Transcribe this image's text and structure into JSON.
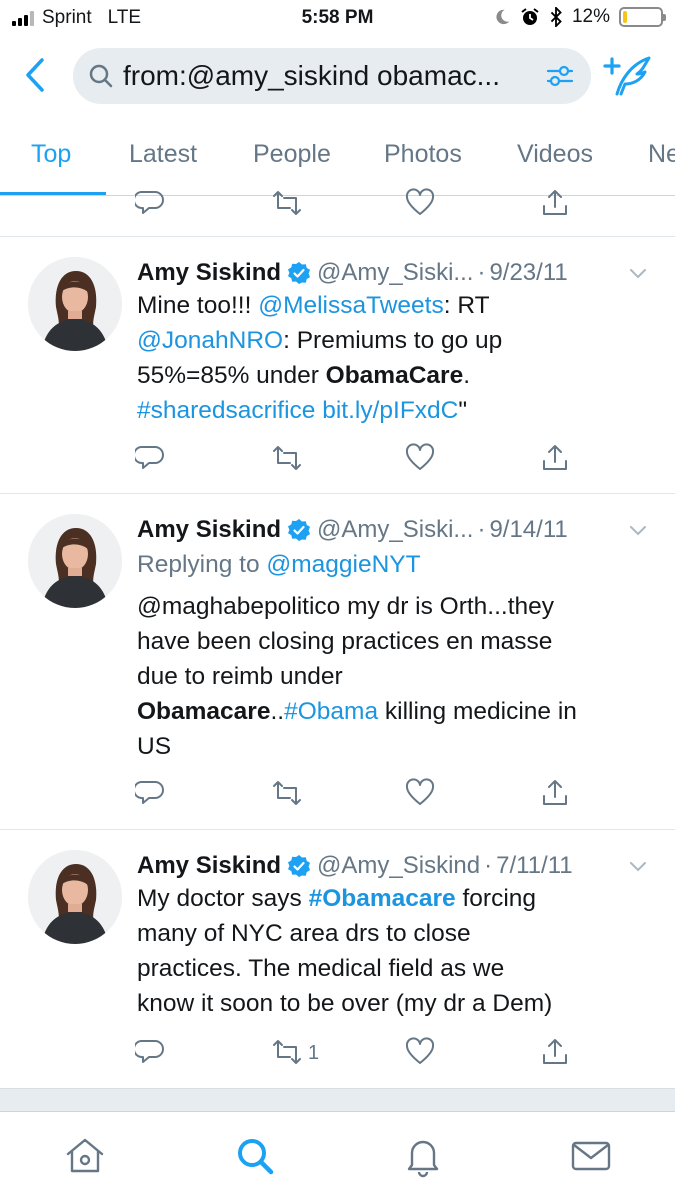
{
  "status_bar": {
    "carrier": "Sprint",
    "network": "LTE",
    "time": "5:58 PM",
    "battery": "12%",
    "battery_level": 0.12,
    "battery_color": "#f5c518"
  },
  "search": {
    "query": "from:@amy_siskind obamac...",
    "back_icon": "chevron-left-icon",
    "filter_icon": "filter-icon",
    "compose_icon": "compose-tweet-icon"
  },
  "tabs": [
    {
      "label": "Top",
      "active": true
    },
    {
      "label": "Latest",
      "active": false
    },
    {
      "label": "People",
      "active": false
    },
    {
      "label": "Photos",
      "active": false
    },
    {
      "label": "Videos",
      "active": false
    },
    {
      "label": "Ne",
      "active": false
    }
  ],
  "tweets": [
    {
      "name": "Amy Siskind",
      "handle": "@Amy_Siski...",
      "date": "9/23/11",
      "body": {
        "l1a": "Mine too!!! ",
        "l1link": "@MelissaTweets",
        "l1b": ": RT",
        "l2link": "@JonahNRO",
        "l2b": ": Premiums to go up",
        "l3a": "55%=85% under ",
        "l3bold": "ObamaCare",
        "l3b": ".",
        "l4link1": "#sharedsacrifice",
        "l4link2": "bit.ly/pIFxdC",
        "l4b": "\""
      },
      "retweets": ""
    },
    {
      "name": "Amy Siskind",
      "handle": "@Amy_Siski...",
      "date": "9/14/11",
      "body": {
        "reply_prefix": "Replying to ",
        "reply_link": "@maggieNYT",
        "l1": "@maghabepolitico my dr is Orth...they",
        "l2": "have been closing practices en masse",
        "l3": "due to reimb under",
        "l4bold": "Obamacare",
        "l4a": "..",
        "l4link": "#Obama",
        "l4b": " killing medicine in",
        "l5": "US"
      },
      "retweets": ""
    },
    {
      "name": "Amy Siskind",
      "handle": "@Amy_Siskind",
      "date": "7/11/11",
      "body": {
        "l1a": "My doctor says ",
        "l1link": "#Obamacare",
        "l1b": " forcing",
        "l2": "many of NYC area drs to close",
        "l3": "practices.  The medical field as we",
        "l4": "know it soon to be over (my dr a Dem)"
      },
      "retweets": "1"
    }
  ],
  "bottom_nav": [
    {
      "icon": "home-icon"
    },
    {
      "icon": "search-icon",
      "active": true
    },
    {
      "icon": "notifications-bell-icon"
    },
    {
      "icon": "messages-envelope-icon"
    }
  ],
  "colors": {
    "accent": "#1da1f2",
    "link": "#1b95e0",
    "muted": "#657786",
    "text": "#14171a"
  }
}
